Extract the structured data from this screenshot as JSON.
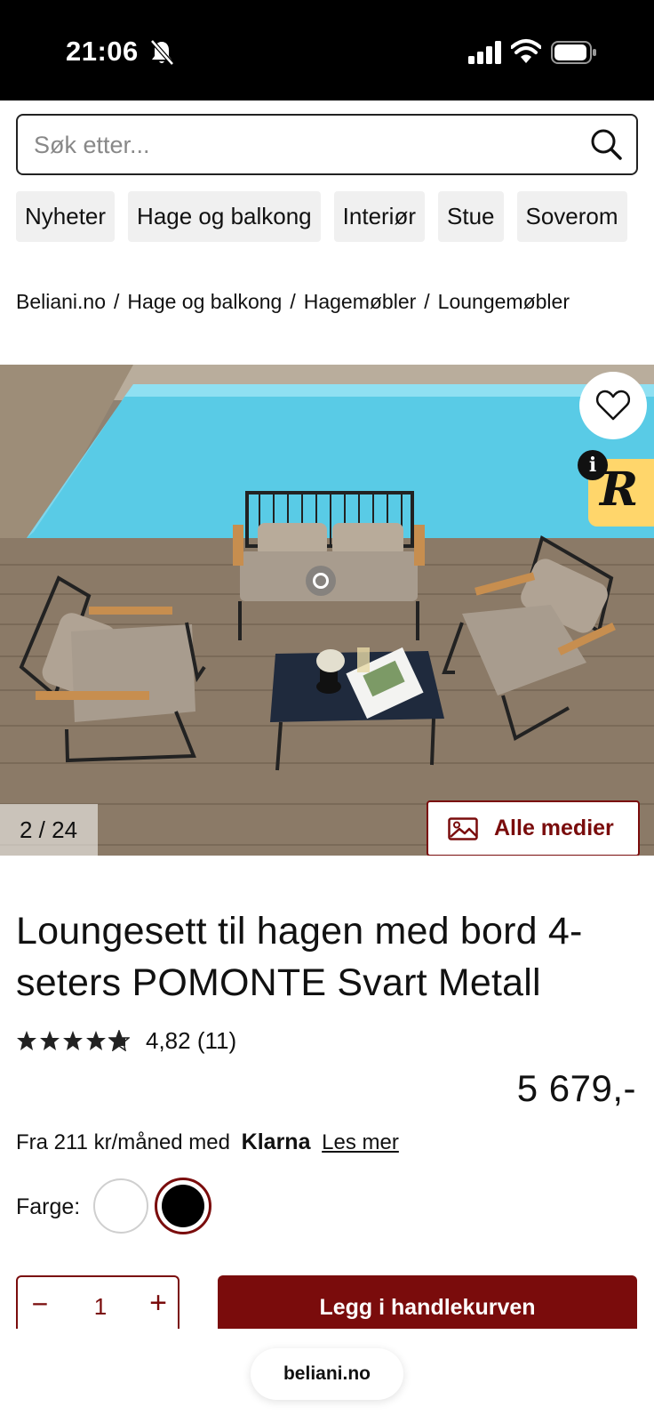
{
  "status_bar": {
    "time": "21:06",
    "icons": [
      "bell-slash-icon",
      "signal-icon",
      "wifi-icon",
      "battery-icon"
    ]
  },
  "search": {
    "placeholder": "Søk etter...",
    "value": ""
  },
  "categories": [
    "Nyheter",
    "Hage og balkong",
    "Interiør",
    "Stue",
    "Soverom"
  ],
  "breadcrumb": [
    "Beliani.no",
    "Hage og balkong",
    "Hagemøbler",
    "Loungemøbler"
  ],
  "gallery": {
    "counter": "2 / 24",
    "all_media_label": "Alle medier"
  },
  "product": {
    "title": "Loungesett til hagen med bord 4-seters POMONTE Svart Metall",
    "rating_value": 4.82,
    "rating_text": "4,82 (11)",
    "price": "5 679,-",
    "klarna_prefix": "Fra 211 kr/måned med",
    "klarna_brand": "Klarna",
    "klarna_link": "Les mer",
    "color_label": "Farge:",
    "colors": [
      "#ffffff",
      "#000000"
    ],
    "selected_color": "#000000",
    "quantity": "1",
    "add_to_cart": "Legg i handlekurven"
  },
  "browser": {
    "url": "beliani.no"
  },
  "theme": {
    "accent": "#7a0c0c",
    "review_badge": "#ffd66b"
  }
}
